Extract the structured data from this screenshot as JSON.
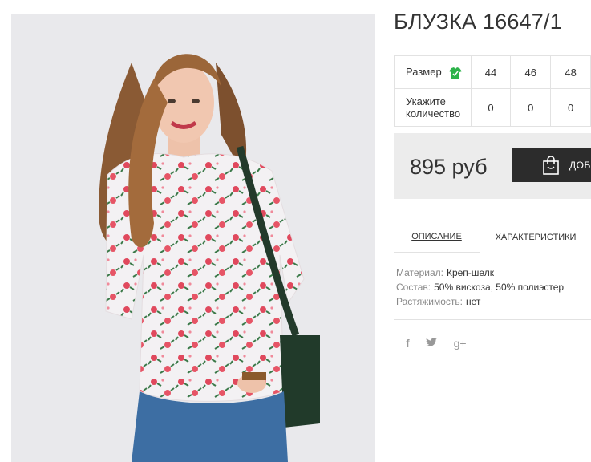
{
  "product": {
    "title": "БЛУЗКА 16647/1",
    "image_alt": "woman-in-floral-blouse"
  },
  "sizes": {
    "row1_label": "Размер",
    "row2_label": "Укажите количество",
    "values": [
      "44",
      "46",
      "48"
    ],
    "quantities": [
      "0",
      "0",
      "0"
    ]
  },
  "purchase": {
    "price": "895 руб",
    "add_button_label": "ДОБА"
  },
  "tabs": {
    "description": "ОПИСАНИЕ",
    "characteristics": "ХАРАКТЕРИСТИКИ"
  },
  "characteristics": [
    {
      "key": "Материал:",
      "value": "Креп-шелк"
    },
    {
      "key": "Состав:",
      "value": "50% вискоза, 50% полиэстер"
    },
    {
      "key": "Растяжимость:",
      "value": "нет"
    }
  ],
  "social": {
    "facebook": "f",
    "twitter": "t",
    "googleplus": "g+"
  },
  "colors": {
    "accent_green": "#2db34a",
    "button_dark": "#2c2c2c",
    "price_bg": "#ececec"
  }
}
